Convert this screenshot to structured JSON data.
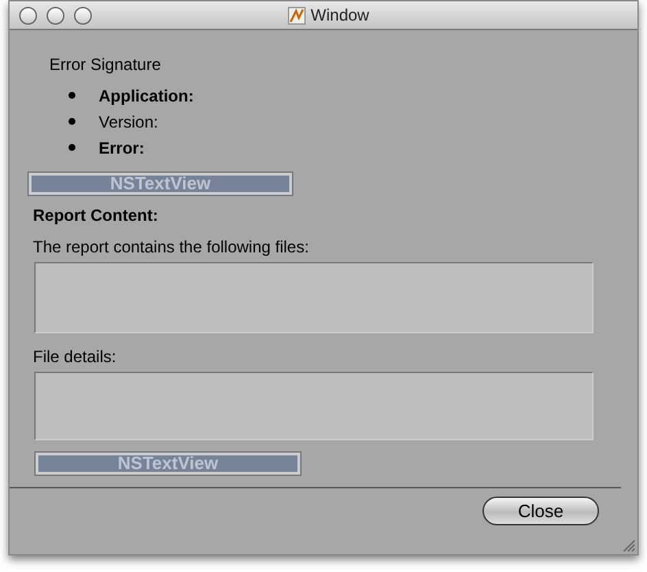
{
  "window": {
    "title": "Window"
  },
  "error_signature": {
    "heading": "Error Signature",
    "items": [
      {
        "label": "Application:",
        "bold": true
      },
      {
        "label": "Version:",
        "bold": false
      },
      {
        "label": "Error:",
        "bold": true
      }
    ]
  },
  "text_views": [
    "NSTextView",
    "NSTextView"
  ],
  "report_heading": "Report Content:",
  "files_label": "The report contains the following files:",
  "details_label": "File details:",
  "buttons": [
    "Close"
  ]
}
